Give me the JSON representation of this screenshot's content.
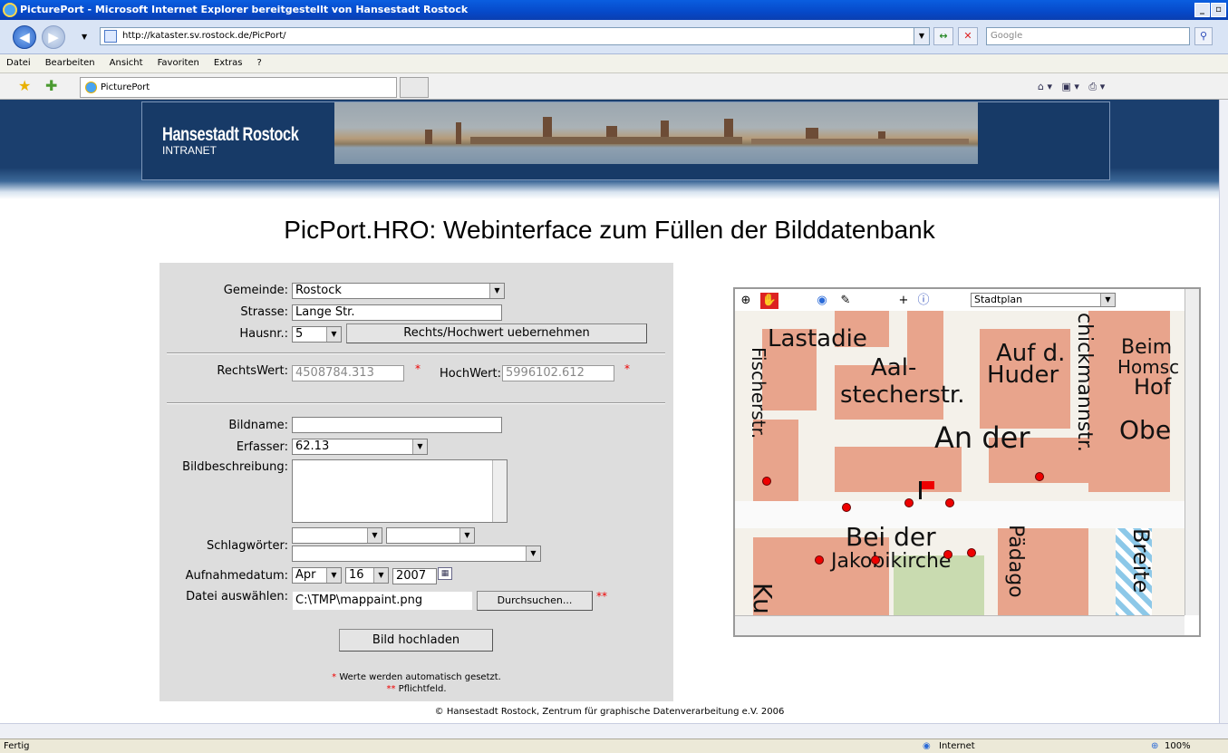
{
  "window": {
    "title": "PicturePort - Microsoft Internet Explorer bereitgestellt von Hansestadt Rostock"
  },
  "address": {
    "url": "http://kataster.sv.rostock.de/PicPort/",
    "search_placeholder": "Google"
  },
  "menu": [
    "Datei",
    "Bearbeiten",
    "Ansicht",
    "Favoriten",
    "Extras",
    "?"
  ],
  "tab": {
    "label": "PicturePort"
  },
  "banner": {
    "logo_title": "Hansestadt Rostock",
    "logo_sub": "INTRANET"
  },
  "page": {
    "heading": "PicPort.HRO: Webinterface zum Füllen der Bilddatenbank"
  },
  "form": {
    "gemeinde_label": "Gemeinde:",
    "gemeinde_value": "Rostock",
    "strasse_label": "Strasse:",
    "strasse_value": "Lange Str.",
    "hausnr_label": "Hausnr.:",
    "hausnr_value": "5",
    "rechtshoch_button": "Rechts/Hochwert uebernehmen",
    "rechtswert_label": "RechtsWert:",
    "rechtswert_value": "4508784.313",
    "hochwert_label": "HochWert:",
    "hochwert_value": "5996102.612",
    "bildname_label": "Bildname:",
    "bildname_value": "",
    "erfasser_label": "Erfasser:",
    "erfasser_value": "62.13",
    "bildbeschreibung_label": "Bildbeschreibung:",
    "schlagwoerter_label": "Schlagwörter:",
    "aufnahmedatum_label": "Aufnahmedatum:",
    "month": "Apr",
    "day": "16",
    "year": "2007",
    "datei_label": "Datei auswählen:",
    "datei_value": "C:\\TMP\\mappaint.png",
    "browse_button": "Durchsuchen...",
    "upload_button": "Bild hochladen",
    "note_auto": "Werte werden automatisch gesetzt.",
    "note_required": "Pflichtfeld.",
    "star": "*",
    "doublestar": "**"
  },
  "map": {
    "layer_select": "Stadtplan",
    "labels": [
      "Lastadie",
      "Aal-",
      "stecherstr.",
      "Auf d.",
      "Huder",
      "chickmannstr.",
      "Beim",
      "Homsc",
      "Hof",
      "Obe",
      "An der",
      "Fischerstr.",
      "Bei der",
      "Jakobikirche",
      "Pädago",
      "Breite",
      "Ku"
    ]
  },
  "footer": {
    "text": "© Hansestadt Rostock, Zentrum für graphische Datenverarbeitung e.V. 2006"
  },
  "status": {
    "left": "Fertig",
    "zone": "Internet",
    "zoom": "100%"
  }
}
